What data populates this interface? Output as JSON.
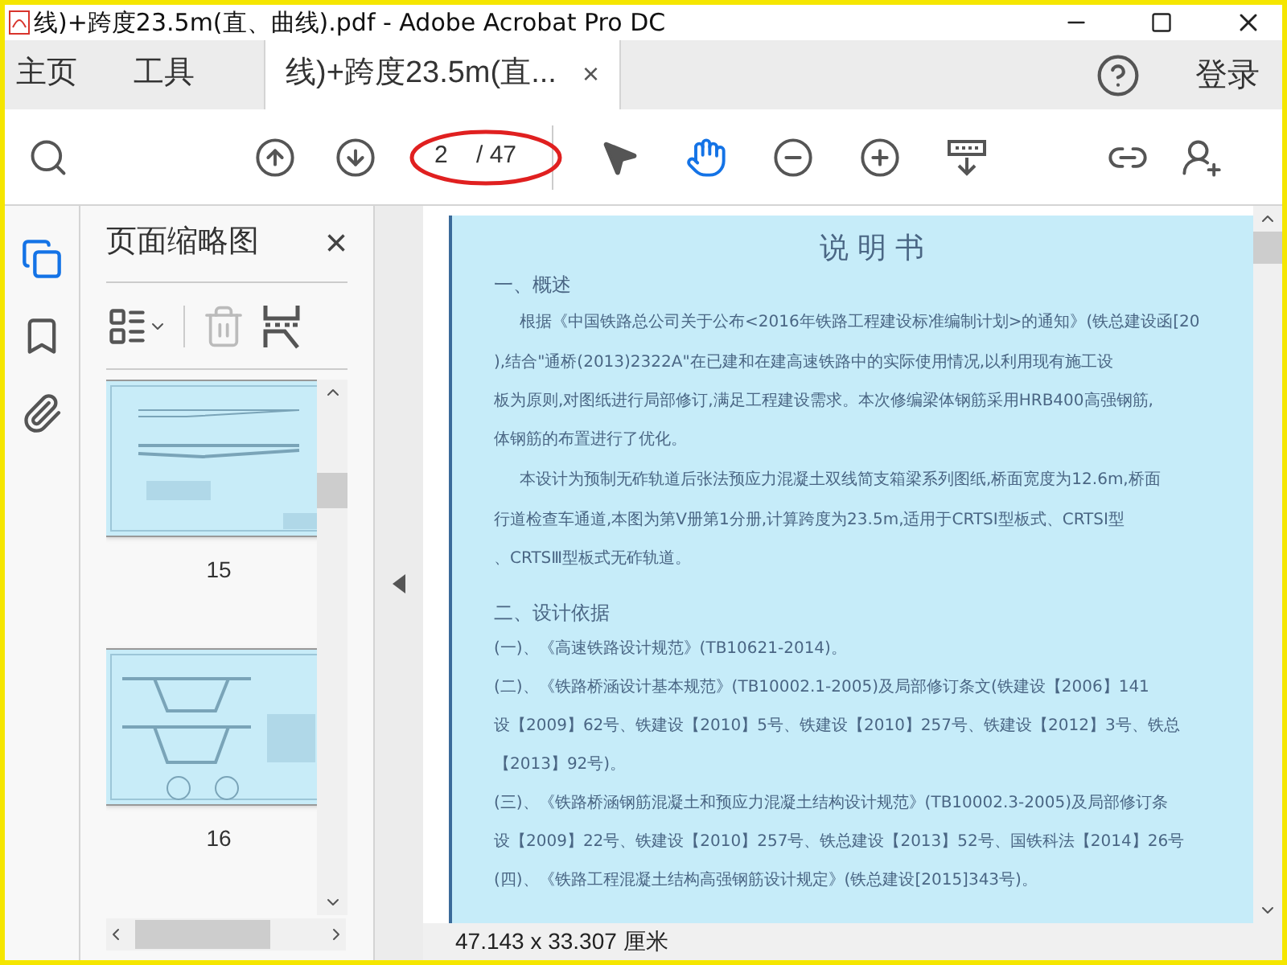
{
  "window": {
    "title": "线)+跨度23.5m(直、曲线).pdf - Adobe Acrobat Pro DC"
  },
  "tabs": [
    {
      "label": "主页",
      "kind": "nav",
      "selected": false
    },
    {
      "label": "工具",
      "kind": "nav",
      "selected": false
    },
    {
      "label": "线)+跨度23.5m(直...",
      "kind": "document",
      "selected": true,
      "close": "×"
    }
  ],
  "header_right": {
    "signin": "登录"
  },
  "toolbar": {
    "tools": [
      {
        "kind": "find",
        "selected": false
      },
      {
        "kind": "prev",
        "selected": false
      },
      {
        "kind": "next",
        "selected": false
      },
      {
        "kind": "page",
        "current": "2",
        "total": "/ 47"
      },
      {
        "kind": "select",
        "selected": false
      },
      {
        "kind": "hand",
        "selected": true
      },
      {
        "kind": "zoom-out",
        "selected": false
      },
      {
        "kind": "zoom-in",
        "selected": false
      },
      {
        "kind": "scroll-mode",
        "selected": false
      },
      {
        "kind": "share",
        "selected": false
      },
      {
        "kind": "add-user",
        "selected": false
      }
    ]
  },
  "side_rail": [
    {
      "kind": "pages",
      "selected": true
    },
    {
      "kind": "bookmarks",
      "selected": false
    },
    {
      "kind": "attachments",
      "selected": false
    }
  ],
  "thumbnail_panel": {
    "title": "页面缩略图",
    "close": "×",
    "actions": [
      {
        "kind": "options",
        "disabled": false
      },
      {
        "kind": "delete",
        "disabled": true
      },
      {
        "kind": "extract",
        "disabled": false
      }
    ],
    "thumbnails": [
      {
        "label": "15"
      },
      {
        "label": "16"
      }
    ]
  },
  "document": {
    "lines": [
      {
        "kind": "title",
        "text": "说 明 书"
      },
      {
        "kind": "heading",
        "text": "一、概述"
      },
      {
        "kind": "indented",
        "text": "根据《中国铁路总公司关于公布<2016年铁路工程建设标准编制计划>的通知》(铁总建设函[20"
      },
      {
        "kind": "line",
        "text": "),结合\"通桥(2013)2322A\"在已建和在建高速铁路中的实际使用情况,以利用现有施工设"
      },
      {
        "kind": "line",
        "text": "板为原则,对图纸进行局部修订,满足工程建设需求。本次修编梁体钢筋采用HRB400高强钢筋,"
      },
      {
        "kind": "line",
        "text": "体钢筋的布置进行了优化。"
      },
      {
        "kind": "indented",
        "text": "本设计为预制无砟轨道后张法预应力混凝土双线简支箱梁系列图纸,桥面宽度为12.6m,桥面"
      },
      {
        "kind": "line",
        "text": "行道检查车通道,本图为第Ⅴ册第1分册,计算跨度为23.5m,适用于CRTSⅠ型板式、CRTSⅠ型"
      },
      {
        "kind": "line",
        "text": "、CRTSⅢ型板式无砟轨道。"
      },
      {
        "kind": "heading",
        "text": "二、设计依据"
      },
      {
        "kind": "line",
        "text": "(一)、《高速铁路设计规范》(TB10621-2014)。"
      },
      {
        "kind": "line",
        "text": "(二)、《铁路桥涵设计基本规范》(TB10002.1-2005)及局部修订条文(铁建设【2006】141"
      },
      {
        "kind": "line",
        "text": "设【2009】62号、铁建设【2010】5号、铁建设【2010】257号、铁建设【2012】3号、铁总"
      },
      {
        "kind": "line",
        "text": "【2013】92号)。"
      },
      {
        "kind": "line",
        "text": "(三)、《铁路桥涵钢筋混凝土和预应力混凝土结构设计规范》(TB10002.3-2005)及局部修订条"
      },
      {
        "kind": "line",
        "text": "设【2009】22号、铁建设【2010】257号、铁总建设【2013】52号、国铁科法【2014】26号"
      },
      {
        "kind": "line",
        "text": "(四)、《铁路工程混凝土结构高强钢筋设计规定》(铁总建设[2015]343号)。"
      }
    ]
  },
  "status_bar": {
    "page_size": "47.143 x 33.307 厘米"
  }
}
